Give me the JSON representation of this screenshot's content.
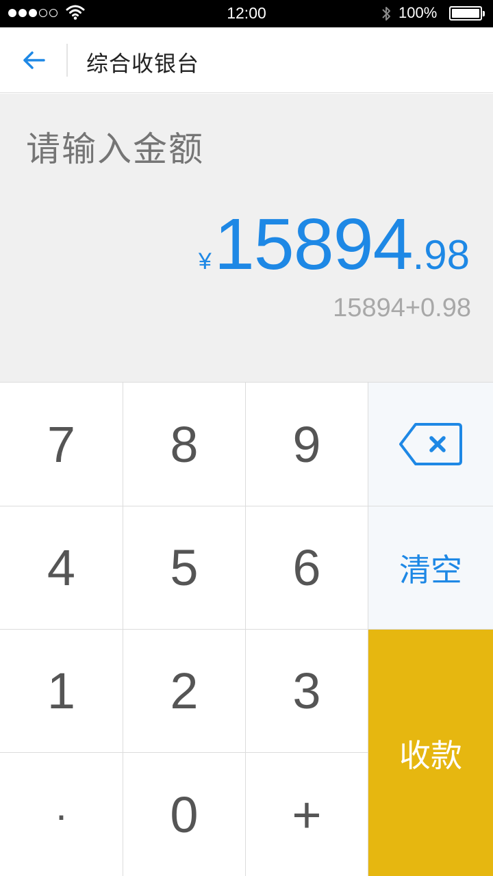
{
  "status_bar": {
    "time": "12:00",
    "battery": "100%"
  },
  "nav": {
    "title": "综合收银台"
  },
  "display": {
    "placeholder": "请输入金额",
    "currency_symbol": "¥",
    "amount_integer": "15894",
    "amount_decimal": ".98",
    "expression": "15894+0.98"
  },
  "keypad": {
    "keys": [
      "7",
      "8",
      "9",
      "4",
      "5",
      "6",
      "1",
      "2",
      "3",
      "·",
      "0",
      "+"
    ],
    "clear_label": "清空",
    "pay_label": "收款"
  },
  "colors": {
    "accent": "#1e88e5",
    "pay": "#e6b710",
    "display_bg": "#f0f0f0"
  }
}
